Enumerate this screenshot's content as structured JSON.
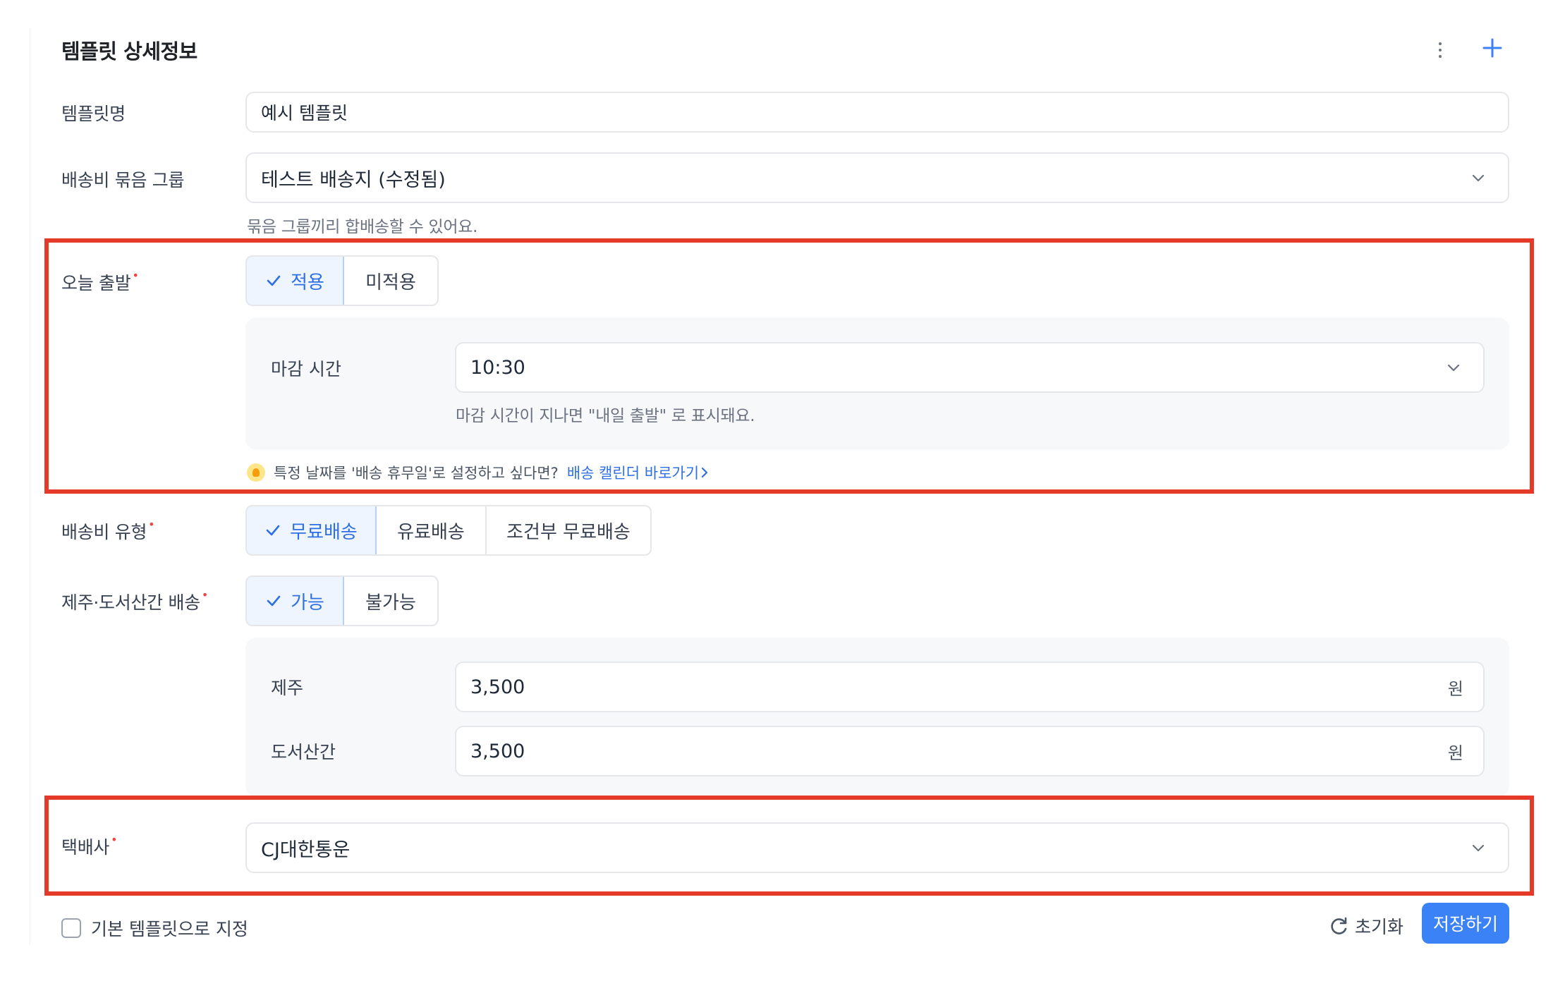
{
  "header": {
    "title": "템플릿 상세정보"
  },
  "template_name": {
    "label": "템플릿명",
    "value": "예시 템플릿"
  },
  "bundle_group": {
    "label": "배송비 묶음 그룹",
    "value": "테스트 배송지 (수정됨)",
    "help": "묶음 그룹끼리 합배송할 수 있어요."
  },
  "today_dispatch": {
    "label": "오늘 출발",
    "required_mark": "•",
    "options": [
      "적용",
      "미적용"
    ],
    "selected": "적용",
    "cutoff_label": "마감 시간",
    "cutoff_value": "10:30",
    "cutoff_help": "마감 시간이 지나면 \"내일 출발\" 로 표시돼요.",
    "tip_text": "특정 날짜를 '배송 휴무일'로 설정하고 싶다면?",
    "tip_link": "배송 캘린더 바로가기"
  },
  "shipping_fee_type": {
    "label": "배송비 유형",
    "required_mark": "•",
    "options": [
      "무료배송",
      "유료배송",
      "조건부 무료배송"
    ],
    "selected": "무료배송"
  },
  "jeju_island": {
    "label": "제주·도서산간 배송",
    "required_mark": "•",
    "options": [
      "가능",
      "불가능"
    ],
    "selected": "가능",
    "jeju_label": "제주",
    "jeju_value": "3,500",
    "island_label": "도서산간",
    "island_value": "3,500",
    "unit": "원"
  },
  "courier": {
    "label": "택배사",
    "required_mark": "•",
    "value": "CJ대한통운"
  },
  "footer": {
    "default_checkbox_label": "기본 템플릿으로 지정",
    "reset_label": "초기화",
    "save_label": "저장하기"
  },
  "colors": {
    "accent": "#3b82f6",
    "highlight_border": "#e53a2a",
    "required": "#ef4444"
  }
}
